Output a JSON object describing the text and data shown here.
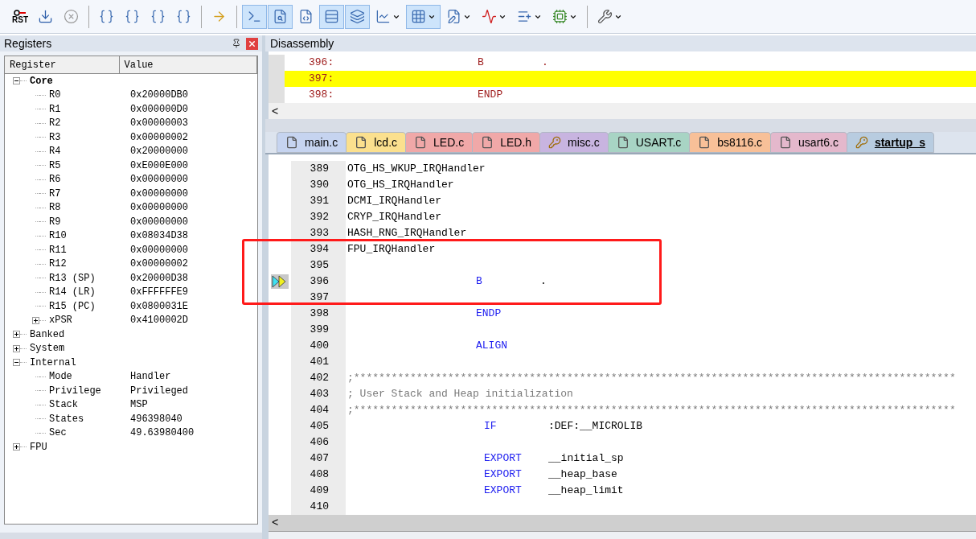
{
  "toolbar": {
    "reset_label": "RST",
    "buttons": [
      {
        "kind": "reset",
        "selected": false,
        "dropdown": false
      },
      {
        "kind": "download",
        "selected": false,
        "dropdown": false
      },
      {
        "kind": "stop",
        "selected": false,
        "dropdown": false
      },
      {
        "kind": "separator"
      },
      {
        "kind": "step-in",
        "selected": false,
        "dropdown": false
      },
      {
        "kind": "step-over",
        "selected": false,
        "dropdown": false
      },
      {
        "kind": "step-out",
        "selected": false,
        "dropdown": false
      },
      {
        "kind": "run-to",
        "selected": false,
        "dropdown": false
      },
      {
        "kind": "separator"
      },
      {
        "kind": "arrow",
        "selected": false,
        "dropdown": false
      },
      {
        "kind": "separator"
      },
      {
        "kind": "console",
        "selected": true,
        "dropdown": false
      },
      {
        "kind": "disasm",
        "selected": true,
        "dropdown": false
      },
      {
        "kind": "symbols",
        "selected": false,
        "dropdown": false
      },
      {
        "kind": "registers",
        "selected": true,
        "dropdown": false
      },
      {
        "kind": "callstack",
        "selected": true,
        "dropdown": false
      },
      {
        "kind": "watch",
        "selected": false,
        "dropdown": true
      },
      {
        "kind": "memory",
        "selected": true,
        "dropdown": true
      },
      {
        "kind": "serial",
        "selected": false,
        "dropdown": true
      },
      {
        "kind": "analysis",
        "selected": false,
        "dropdown": true
      },
      {
        "kind": "trace",
        "selected": false,
        "dropdown": true
      },
      {
        "kind": "peripheral",
        "selected": false,
        "dropdown": true
      },
      {
        "kind": "separator"
      },
      {
        "kind": "tools",
        "selected": false,
        "dropdown": true
      }
    ]
  },
  "registers": {
    "title": "Registers",
    "columns": [
      "Register",
      "Value"
    ],
    "tree": [
      {
        "name": "Core",
        "bold": true,
        "expanded": true,
        "children": [
          {
            "name": "R0",
            "value": "0x20000DB0"
          },
          {
            "name": "R1",
            "value": "0x000000D0"
          },
          {
            "name": "R2",
            "value": "0x00000003"
          },
          {
            "name": "R3",
            "value": "0x00000002"
          },
          {
            "name": "R4",
            "value": "0x20000000"
          },
          {
            "name": "R5",
            "value": "0xE000E000"
          },
          {
            "name": "R6",
            "value": "0x00000000"
          },
          {
            "name": "R7",
            "value": "0x00000000"
          },
          {
            "name": "R8",
            "value": "0x00000000"
          },
          {
            "name": "R9",
            "value": "0x00000000"
          },
          {
            "name": "R10",
            "value": "0x08034D38"
          },
          {
            "name": "R11",
            "value": "0x00000000"
          },
          {
            "name": "R12",
            "value": "0x00000002"
          },
          {
            "name": "R13 (SP)",
            "value": "0x20000D38"
          },
          {
            "name": "R14 (LR)",
            "value": "0xFFFFFFE9"
          },
          {
            "name": "R15 (PC)",
            "value": "0x0800031E"
          },
          {
            "name": "xPSR",
            "value": "0x4100002D",
            "expanded": false
          }
        ]
      },
      {
        "name": "Banked",
        "bold": false,
        "expanded": false
      },
      {
        "name": "System",
        "bold": false,
        "expanded": false
      },
      {
        "name": "Internal",
        "bold": false,
        "expanded": true,
        "children": [
          {
            "name": "Mode",
            "value": "Handler"
          },
          {
            "name": "Privilege",
            "value": "Privileged"
          },
          {
            "name": "Stack",
            "value": "MSP"
          },
          {
            "name": "States",
            "value": "496398040"
          },
          {
            "name": "Sec",
            "value": "49.63980400"
          }
        ]
      },
      {
        "name": "FPU",
        "bold": false,
        "expanded": false
      }
    ]
  },
  "disassembly": {
    "title": "Disassembly",
    "scroll_left": "<",
    "lines": [
      {
        "address": "396:",
        "instruction": "B",
        "operand": ".",
        "selected": false
      },
      {
        "address": "397:",
        "selected": true
      },
      {
        "address": "398:",
        "instruction": "ENDP",
        "selected": false
      }
    ]
  },
  "file_tabs": [
    {
      "label": "main.c",
      "kind": "file",
      "color": "#c6d4f0",
      "selected": false
    },
    {
      "label": "lcd.c",
      "kind": "file",
      "color": "#fbe08e",
      "selected": false
    },
    {
      "label": "LED.c",
      "kind": "file",
      "color": "#f0a8a8",
      "selected": false
    },
    {
      "label": "LED.h",
      "kind": "file",
      "color": "#f0a8a8",
      "selected": false
    },
    {
      "label": "misc.c",
      "kind": "key",
      "color": "#c8b4e0",
      "selected": false
    },
    {
      "label": "USART.c",
      "kind": "file",
      "color": "#a8d4c4",
      "selected": false
    },
    {
      "label": "bs8116.c",
      "kind": "file",
      "color": "#f8c098",
      "selected": false
    },
    {
      "label": "usart6.c",
      "kind": "file",
      "color": "#e4b8cc",
      "selected": false
    },
    {
      "label": "startup_s",
      "kind": "key",
      "color": "#b8cce0",
      "selected": true
    }
  ],
  "editor": {
    "scroll_left": "<",
    "lines": [
      {
        "number": "389",
        "kind": "label",
        "text": "OTG_HS_WKUP_IRQHandler",
        "current": false
      },
      {
        "number": "390",
        "kind": "label",
        "text": "OTG_HS_IRQHandler",
        "current": false
      },
      {
        "number": "391",
        "kind": "label",
        "text": "DCMI_IRQHandler",
        "current": false
      },
      {
        "number": "392",
        "kind": "label",
        "text": "CRYP_IRQHandler",
        "current": false
      },
      {
        "number": "393",
        "kind": "label",
        "text": "HASH_RNG_IRQHandler",
        "current": false
      },
      {
        "number": "394",
        "kind": "label",
        "text": "FPU_IRQHandler",
        "current": false
      },
      {
        "number": "395",
        "kind": "blank",
        "current": false
      },
      {
        "number": "396",
        "kind": "instruction",
        "keyword": "B",
        "operand": ".",
        "current": true
      },
      {
        "number": "397",
        "kind": "blank",
        "current": false
      },
      {
        "number": "398",
        "kind": "instruction",
        "keyword": "ENDP",
        "current": false
      },
      {
        "number": "399",
        "kind": "blank",
        "current": false
      },
      {
        "number": "400",
        "kind": "instruction",
        "keyword": "ALIGN",
        "current": false
      },
      {
        "number": "401",
        "kind": "blank",
        "current": false
      },
      {
        "number": "402",
        "kind": "comment",
        "text": ";************************************************************************************************",
        "current": false
      },
      {
        "number": "403",
        "kind": "comment",
        "text": "; User Stack and Heap initialization",
        "current": false
      },
      {
        "number": "404",
        "kind": "comment",
        "text": ";************************************************************************************************",
        "current": false
      },
      {
        "number": "405",
        "kind": "directive",
        "keyword": "IF",
        "operand": ":DEF:__MICROLIB",
        "current": false
      },
      {
        "number": "406",
        "kind": "blank",
        "current": false
      },
      {
        "number": "407",
        "kind": "directive",
        "keyword": "EXPORT",
        "operand": "__initial_sp",
        "current": false
      },
      {
        "number": "408",
        "kind": "directive",
        "keyword": "EXPORT",
        "operand": "__heap_base",
        "current": false
      },
      {
        "number": "409",
        "kind": "directive",
        "keyword": "EXPORT",
        "operand": "__heap_limit",
        "current": false
      },
      {
        "number": "410",
        "kind": "blank",
        "current": false
      }
    ]
  }
}
